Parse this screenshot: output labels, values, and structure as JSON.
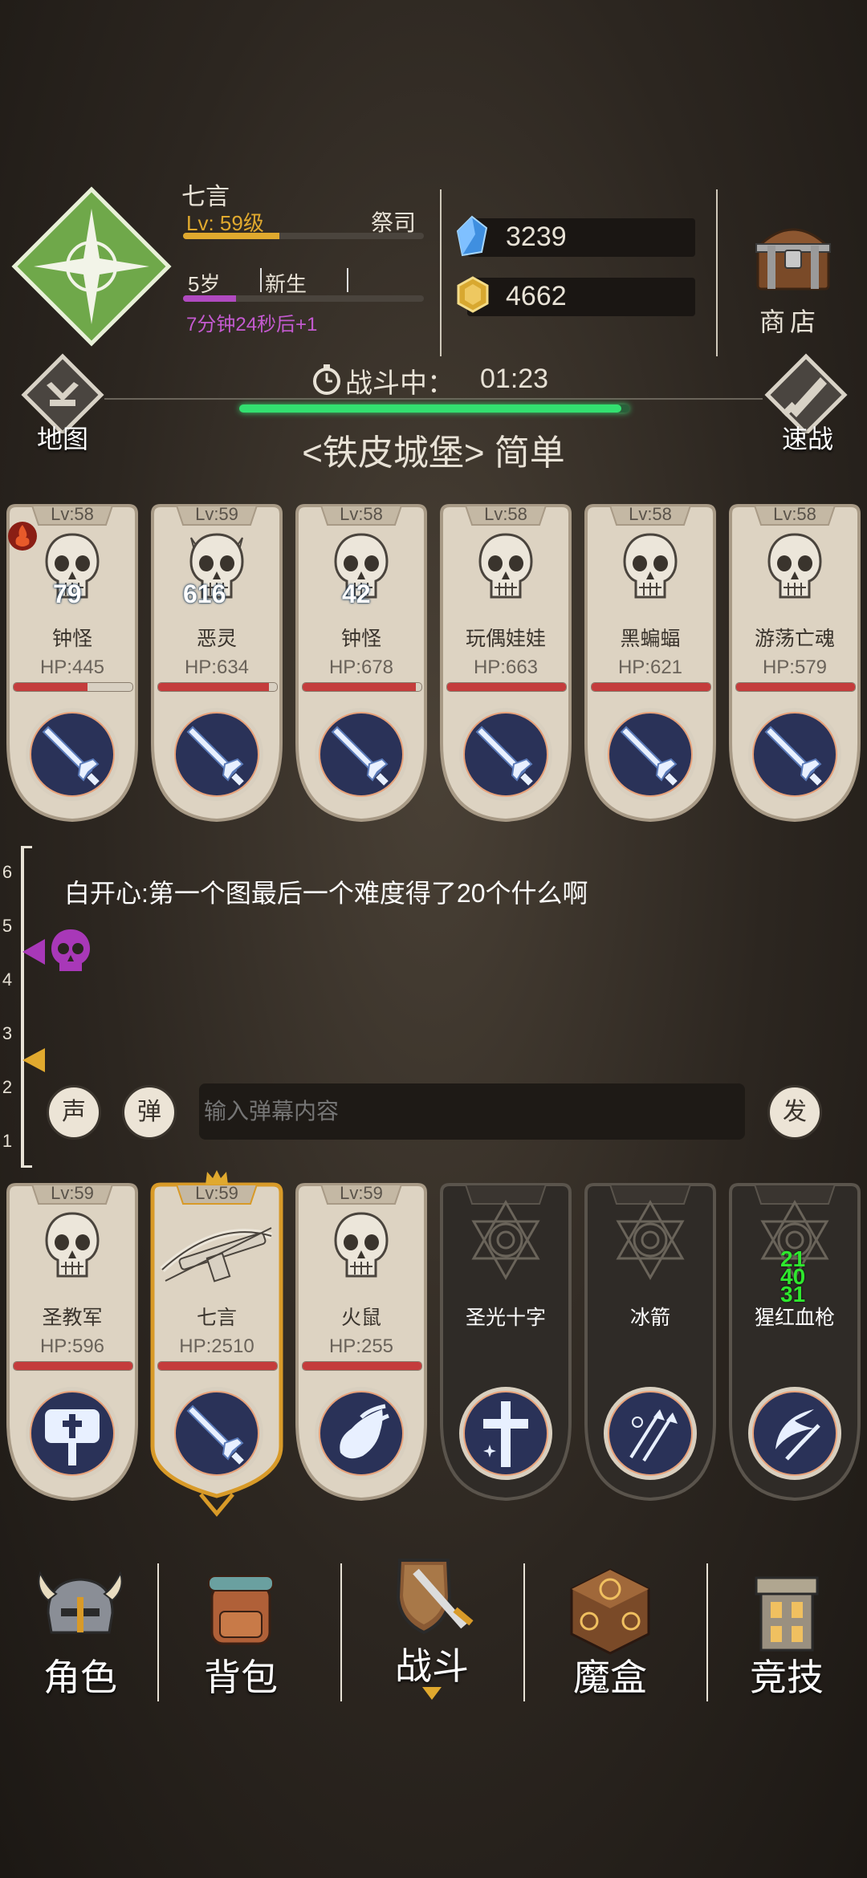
{
  "player": {
    "name": "七言",
    "level": "Lv: 59级",
    "job": "祭司",
    "exp_fraction": 0.4,
    "age": "5岁",
    "stage": "新生",
    "growth_fraction": 0.22,
    "growth_timer": "7分钟24秒后+1"
  },
  "currency": {
    "gems": "3239",
    "gold": "4662"
  },
  "shop_label": "商店",
  "map_label": "地图",
  "quick_battle_label": "速战",
  "battle": {
    "status": "战斗中：",
    "timer": "01:23",
    "progress_fraction": 0.98,
    "dungeon": "<铁皮城堡> 简单"
  },
  "enemies": [
    {
      "lv": "Lv:58",
      "name": "钟怪",
      "hp": "HP:445",
      "hp_fraction": 0.62,
      "damage": "79",
      "skill_icon": "sword-icon"
    },
    {
      "lv": "Lv:59",
      "name": "恶灵",
      "hp": "HP:634",
      "hp_fraction": 0.93,
      "damage": "616",
      "skill_icon": "sword-icon"
    },
    {
      "lv": "Lv:58",
      "name": "钟怪",
      "hp": "HP:678",
      "hp_fraction": 0.95,
      "damage": "42",
      "skill_icon": "sword-icon"
    },
    {
      "lv": "Lv:58",
      "name": "玩偶娃娃",
      "hp": "HP:663",
      "hp_fraction": 1.0,
      "damage": "",
      "skill_icon": "sword-icon"
    },
    {
      "lv": "Lv:58",
      "name": "黑蝙蝠",
      "hp": "HP:621",
      "hp_fraction": 1.0,
      "damage": "",
      "skill_icon": "sword-icon"
    },
    {
      "lv": "Lv:58",
      "name": "游荡亡魂",
      "hp": "HP:579",
      "hp_fraction": 1.0,
      "damage": "",
      "skill_icon": "sword-icon"
    }
  ],
  "lane_numbers": [
    "6",
    "5",
    "4",
    "3",
    "2",
    "1"
  ],
  "danmaku_text": "白开心:第一个图最后一个难度得了20个什么啊",
  "chat": {
    "sound_btn": "声",
    "danmaku_btn": "弹",
    "placeholder": "输入弹幕内容",
    "send_btn": "发"
  },
  "team": [
    {
      "lv": "Lv:59",
      "name": "圣教军",
      "hp": "HP:596",
      "hp_fraction": 1.0,
      "skill_icon": "hammer-icon",
      "leader": false
    },
    {
      "lv": "Lv:59",
      "name": "七言",
      "hp": "HP:2510",
      "hp_fraction": 1.0,
      "skill_icon": "sword-icon",
      "leader": true
    },
    {
      "lv": "Lv:59",
      "name": "火鼠",
      "hp": "HP:255",
      "hp_fraction": 1.0,
      "skill_icon": "fireball-icon",
      "leader": false
    }
  ],
  "skills": [
    {
      "name": "圣光十字",
      "icon": "holy-cross-icon",
      "damage": []
    },
    {
      "name": "冰箭",
      "icon": "ice-arrows-icon",
      "damage": []
    },
    {
      "name": "猩红血枪",
      "icon": "crimson-spear-icon",
      "damage": [
        "21",
        "40",
        "31"
      ]
    }
  ],
  "nav": [
    {
      "label": "角色",
      "icon": "helmet-icon"
    },
    {
      "label": "背包",
      "icon": "backpack-icon"
    },
    {
      "label": "战斗",
      "icon": "shield-sword-icon"
    },
    {
      "label": "魔盒",
      "icon": "magic-box-icon"
    },
    {
      "label": "竞技",
      "icon": "tower-icon"
    }
  ],
  "colors": {
    "accent_gold": "#e0a92e",
    "hp_red": "#c43c3c",
    "progress_green": "#33e070",
    "timer_purple": "#c45ad0"
  }
}
